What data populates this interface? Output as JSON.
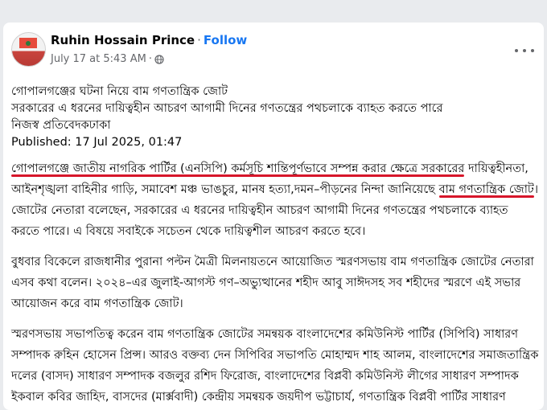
{
  "post": {
    "author": "Ruhin Hossain Prince",
    "separator": "·",
    "follow_label": "Follow",
    "timestamp": "July 17 at 5:43 AM",
    "meta_separator": "·",
    "audience_icon": "globe-icon",
    "more_icon": "more-options-icon"
  },
  "content": {
    "intro_lines": [
      "গোপালগঞ্জের ঘটনা নিয়ে বাম গণতান্ত্রিক জোট",
      "সরকারের এ ধরনের দায়িত্বহীন আচরণ আগামী দিনের গণতন্ত্রের পথচলাকে ব্যাহত করতে পারে",
      "নিজস্ব প্রতিবেদকঢাকা",
      "Published: 17 Jul 2025, 01:47"
    ],
    "p1_u1": "গোপালগঞ্জে জাতীয় নাগরিক পার্টির (এনসিপি) কর্মসূচি শান্তিপূর্ণভাবে সম্পন্ন করার ক্ষেত্রে সরকারের",
    "p1_u2": "দায়িত্বহীনতা, আইনশৃঙ্খলা বাহিনীর গাড়ি, সমাবেশ মঞ্চ ভাঙচুর, মানষ হত্যা,দমন–পীড়নের নিন্দা জানিয়েছে",
    "p1_u3": "বাম গণতান্ত্রিক জোট",
    "p1_rest": "। জোটের নেতারা বলেছেন, সরকারের এ ধরনের দায়িত্বহীন আচরণ আগামী দিনের গণতন্ত্রের পথচলাকে ব্যাহত করতে পারে। এ বিষয়ে সবাইকে সচেতন থেকে দায়িত্বশীল আচরণ করতে হবে।",
    "p2": "বুধবার বিকেলে রাজধানীর পুরানা পল্টন মৈত্রী মিলনায়তনে আয়োজিত স্মরণসভায় বাম গণতান্ত্রিক জোটের নেতারা এসব কথা বলেন। ২০২৪–এর জুলাই-আগস্ট গণ–অভ্যুত্থানের শহীদ আবু সাঈদসহ সব শহীদের স্মরণে এই সভার আয়োজন করে বাম গণতান্ত্রিক জোট।",
    "p3": "স্মরণসভায় সভাপতিত্ব করেন বাম গণতান্ত্রিক জোটের সমন্বয়ক বাংলাদেশের কমিউনিস্ট পার্টির (সিপিবি) সাধারণ সম্পাদক রুহিন হোসেন প্রিন্স। আরও বক্তব্য দেন সিপিবির সভাপতি মোহাম্মদ শাহ আলম, বাংলাদেশের সমাজতান্ত্রিক দলের (বাসদ) সাধারণ সম্পাদক বজলুর রশিদ ফিরোজ, বাংলাদেশের বিপ্লবী কমিউনিস্ট লীগের সাধারণ সম্পাদক ইকবাল কবির জাহিদ, বাসদের (মার্ক্সবাদী) কেন্দ্রীয় সমন্বয়ক জয়দীপ ভট্টাচার্য, গণতান্ত্রিক বিপ্লবী পার্টির সাধারণ সম্পাদক মোশরেফা মিশু, বাংলাদেশের সমাজতান্ত্রিক পার্টির নির্বাহী সভাপতি আব্দুল আলী।"
  }
}
